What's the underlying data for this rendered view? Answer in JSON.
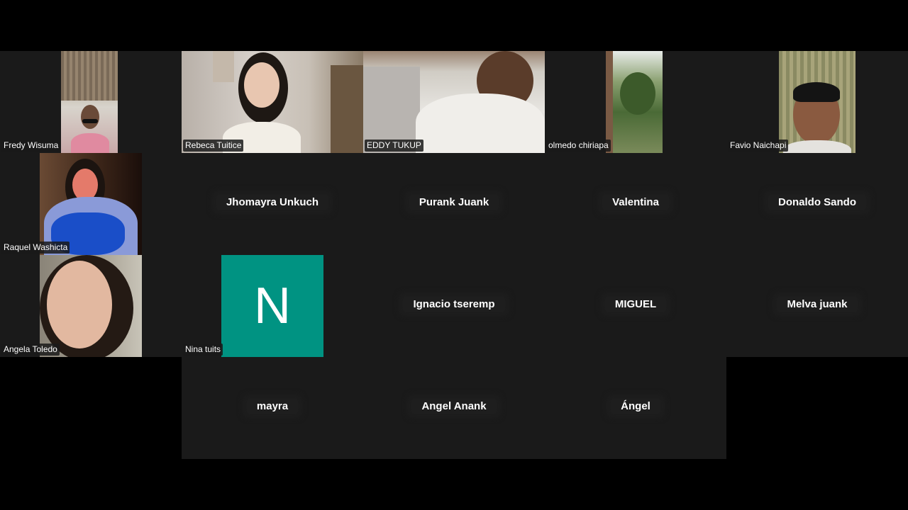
{
  "colors": {
    "background": "#000000",
    "tile_bg": "#1a1a1a",
    "avatar_n": "#009382"
  },
  "participants": [
    {
      "name": "Fredy Wisuma"
    },
    {
      "name": "Rebeca Tuitice"
    },
    {
      "name": "EDDY TUKUP"
    },
    {
      "name": "olmedo chiriapa"
    },
    {
      "name": "Favio Naichapi"
    },
    {
      "name": "Raquel Washicta"
    },
    {
      "name": "Jhomayra Unkuch"
    },
    {
      "name": "Purank Juank"
    },
    {
      "name": "Valentina"
    },
    {
      "name": "Donaldo Sando"
    },
    {
      "name": "Angela Toledo"
    },
    {
      "name": "Nina tuits",
      "avatar_letter": "N"
    },
    {
      "name": "Ignacio tseremp"
    },
    {
      "name": "MIGUEL"
    },
    {
      "name": "Melva juank"
    },
    {
      "name": "mayra"
    },
    {
      "name": "Angel Anank"
    },
    {
      "name": "Ángel"
    }
  ]
}
